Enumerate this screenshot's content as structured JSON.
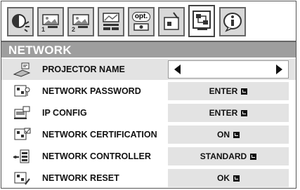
{
  "tabs": [
    {
      "icon": "image-adjust-icon",
      "num": ""
    },
    {
      "icon": "picture-1-icon",
      "num": "1"
    },
    {
      "icon": "picture-2-icon",
      "num": "2"
    },
    {
      "icon": "screen-icon",
      "num": ""
    },
    {
      "icon": "option-icon",
      "label": "opt."
    },
    {
      "icon": "setup-icon",
      "num": ""
    },
    {
      "icon": "network-icon",
      "num": ""
    },
    {
      "icon": "information-icon",
      "num": ""
    }
  ],
  "menu": {
    "title": "NETWORK",
    "items": [
      {
        "label": "PROJECTOR NAME",
        "value": "",
        "icon": "projector-name-icon"
      },
      {
        "label": "NETWORK PASSWORD",
        "value": "ENTER",
        "icon": "password-icon"
      },
      {
        "label": "IP CONFIG",
        "value": "ENTER",
        "icon": "ip-config-icon"
      },
      {
        "label": "NETWORK CERTIFICATION",
        "value": "ON",
        "icon": "certification-icon"
      },
      {
        "label": "NETWORK CONTROLLER",
        "value": "STANDARD",
        "icon": "controller-icon"
      },
      {
        "label": "NETWORK RESET",
        "value": "OK",
        "icon": "reset-icon"
      }
    ]
  }
}
